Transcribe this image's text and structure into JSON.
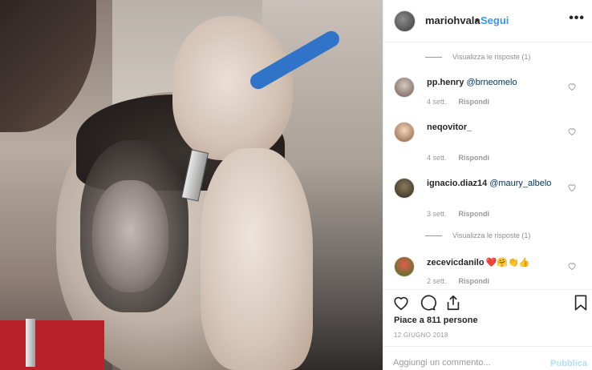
{
  "post": {
    "username": "mariohvala",
    "separator": "•",
    "follow_label": "Segui",
    "more_label": "•••"
  },
  "comments": [
    {
      "type": "replies-toggle",
      "label": "Visualizza le risposte (1)"
    },
    {
      "type": "comment",
      "user": "pp.henry",
      "text": "@brneomelo",
      "emoji": "",
      "time": "4 sett.",
      "reply": "Rispondi"
    },
    {
      "type": "comment",
      "user": "neqovitor_",
      "text": "",
      "emoji": "",
      "time": "4 sett.",
      "reply": "Rispondi"
    },
    {
      "type": "comment",
      "user": "ignacio.diaz14",
      "text": "@maury_albelo",
      "emoji": "",
      "time": "3 sett.",
      "reply": "Rispondi"
    },
    {
      "type": "replies-toggle",
      "label": "Visualizza le risposte (1)"
    },
    {
      "type": "comment",
      "user": "zecevicdanilo",
      "text": "",
      "emoji": "❤️🤗👏👍",
      "time": "2 sett.",
      "reply": "Rispondi"
    }
  ],
  "actions": {
    "like_icon": "heart-outline-icon",
    "comment_icon": "comment-bubble-icon",
    "share_icon": "share-arrow-icon",
    "save_icon": "bookmark-icon"
  },
  "likes_text": "Piace a 811 persone",
  "date_text": "12 GIUGNO 2018",
  "comment_input": {
    "placeholder": "Aggiungi un commento...",
    "value": ""
  },
  "publish_label": "Pubblica",
  "colors": {
    "link": "#3897f0",
    "mention": "#003569",
    "publish_disabled": "#b2dffc",
    "secondary_text": "#999999"
  }
}
